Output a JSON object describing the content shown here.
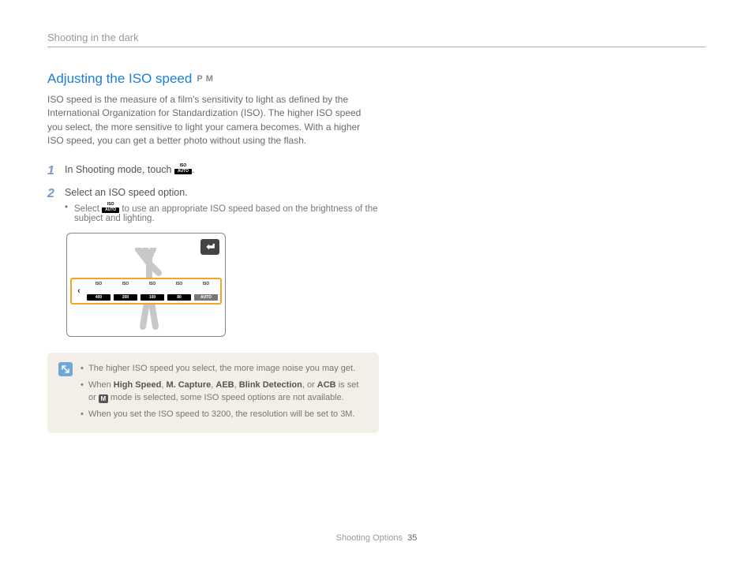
{
  "breadcrumb": "Shooting in the dark",
  "title": "Adjusting the ISO speed",
  "modes": [
    "P",
    "M"
  ],
  "intro": "ISO speed is the measure of a film's sensitivity to light as defined by the International Organization for Standardization (ISO). The higher ISO speed you select, the more sensitive to light your camera becomes. With a higher ISO speed, you can get a better photo without using the flash.",
  "steps": [
    {
      "num": "1",
      "text_before": "In Shooting mode, touch ",
      "text_after": ".",
      "icon": {
        "top": "ISO",
        "bot": "AUTO"
      }
    },
    {
      "num": "2",
      "text": "Select an ISO speed option.",
      "sub_before": "Select ",
      "sub_after": " to use an appropriate ISO speed based on the brightness of the subject and lighting.",
      "icon": {
        "top": "ISO",
        "bot": "AUTO"
      }
    }
  ],
  "iso_strip": {
    "left_arrow": "‹",
    "options": [
      {
        "top": "ISO",
        "bot": "400"
      },
      {
        "top": "ISO",
        "bot": "200"
      },
      {
        "top": "ISO",
        "bot": "100"
      },
      {
        "top": "ISO",
        "bot": "80"
      },
      {
        "top": "ISO",
        "bot": "AUTO",
        "selected": true
      }
    ],
    "overflow": {
      "top": "ISO",
      "bot": "AUTO"
    }
  },
  "notes": {
    "n1": "The higher ISO speed you select, the more image noise you may get.",
    "n2_a": "When ",
    "n2_b1": "High Speed",
    "n2_c1": ", ",
    "n2_b2": "M. Capture",
    "n2_c2": ", ",
    "n2_b3": "AEB",
    "n2_c3": ", ",
    "n2_b4": "Blink Detection",
    "n2_c4": ", or ",
    "n2_b5": "ACB",
    "n2_d": " is set or ",
    "n2_m": "M",
    "n2_e": " mode is selected, some ISO speed options are not available.",
    "n3": "When you set the ISO speed to 3200, the resolution will be set to 3M."
  },
  "footer": {
    "section": "Shooting Options",
    "page": "35"
  }
}
